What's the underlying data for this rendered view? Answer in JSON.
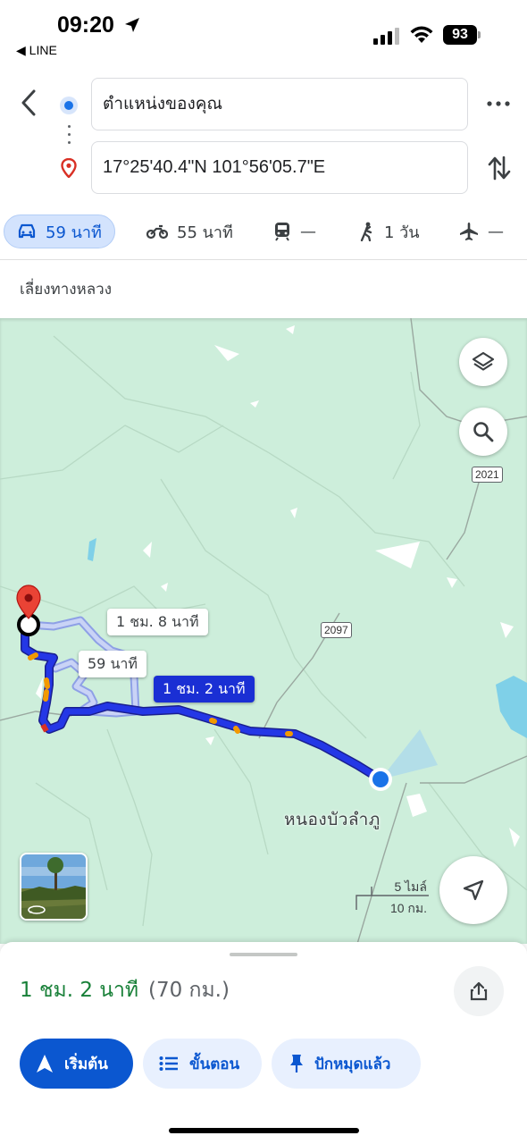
{
  "status_bar": {
    "time": "09:20",
    "back_app": "◀ LINE",
    "battery": "93"
  },
  "route": {
    "origin": "ตำแหน่งของคุณ",
    "destination": "17°25'40.4\"N 101°56'05.7\"E"
  },
  "modes": [
    {
      "icon": "car-icon",
      "label": "59 นาที",
      "active": true
    },
    {
      "icon": "motorcycle-icon",
      "label": "55 นาที",
      "active": false
    },
    {
      "icon": "train-icon",
      "label": "—",
      "active": false
    },
    {
      "icon": "walk-icon",
      "label": "1 วัน",
      "active": false
    },
    {
      "icon": "flight-icon",
      "label": "—",
      "active": false
    }
  ],
  "options": {
    "avoid": "เลี่ยงทางหลวง"
  },
  "map": {
    "route_labels": {
      "alt1": "1 ชม. 8 นาที",
      "alt2": "59 นาที",
      "selected": "1 ชม. 2 นาที"
    },
    "road_shields": [
      "2021",
      "2097"
    ],
    "town": "หนองบัวลำภู",
    "scale": {
      "miles": "5 ไมล์",
      "km": "10 กม."
    },
    "colors": {
      "route": "#1a2fd4",
      "alt_route": "#b8c4f2",
      "land": "#cdeedb",
      "water": "#7fd0e8"
    }
  },
  "sheet": {
    "eta": "1 ชม. 2 นาที",
    "distance": "(70 กม.)",
    "buttons": {
      "start": "เริ่มต้น",
      "steps": "ขั้นตอน",
      "pinned": "ปักหมุดแล้ว"
    }
  }
}
